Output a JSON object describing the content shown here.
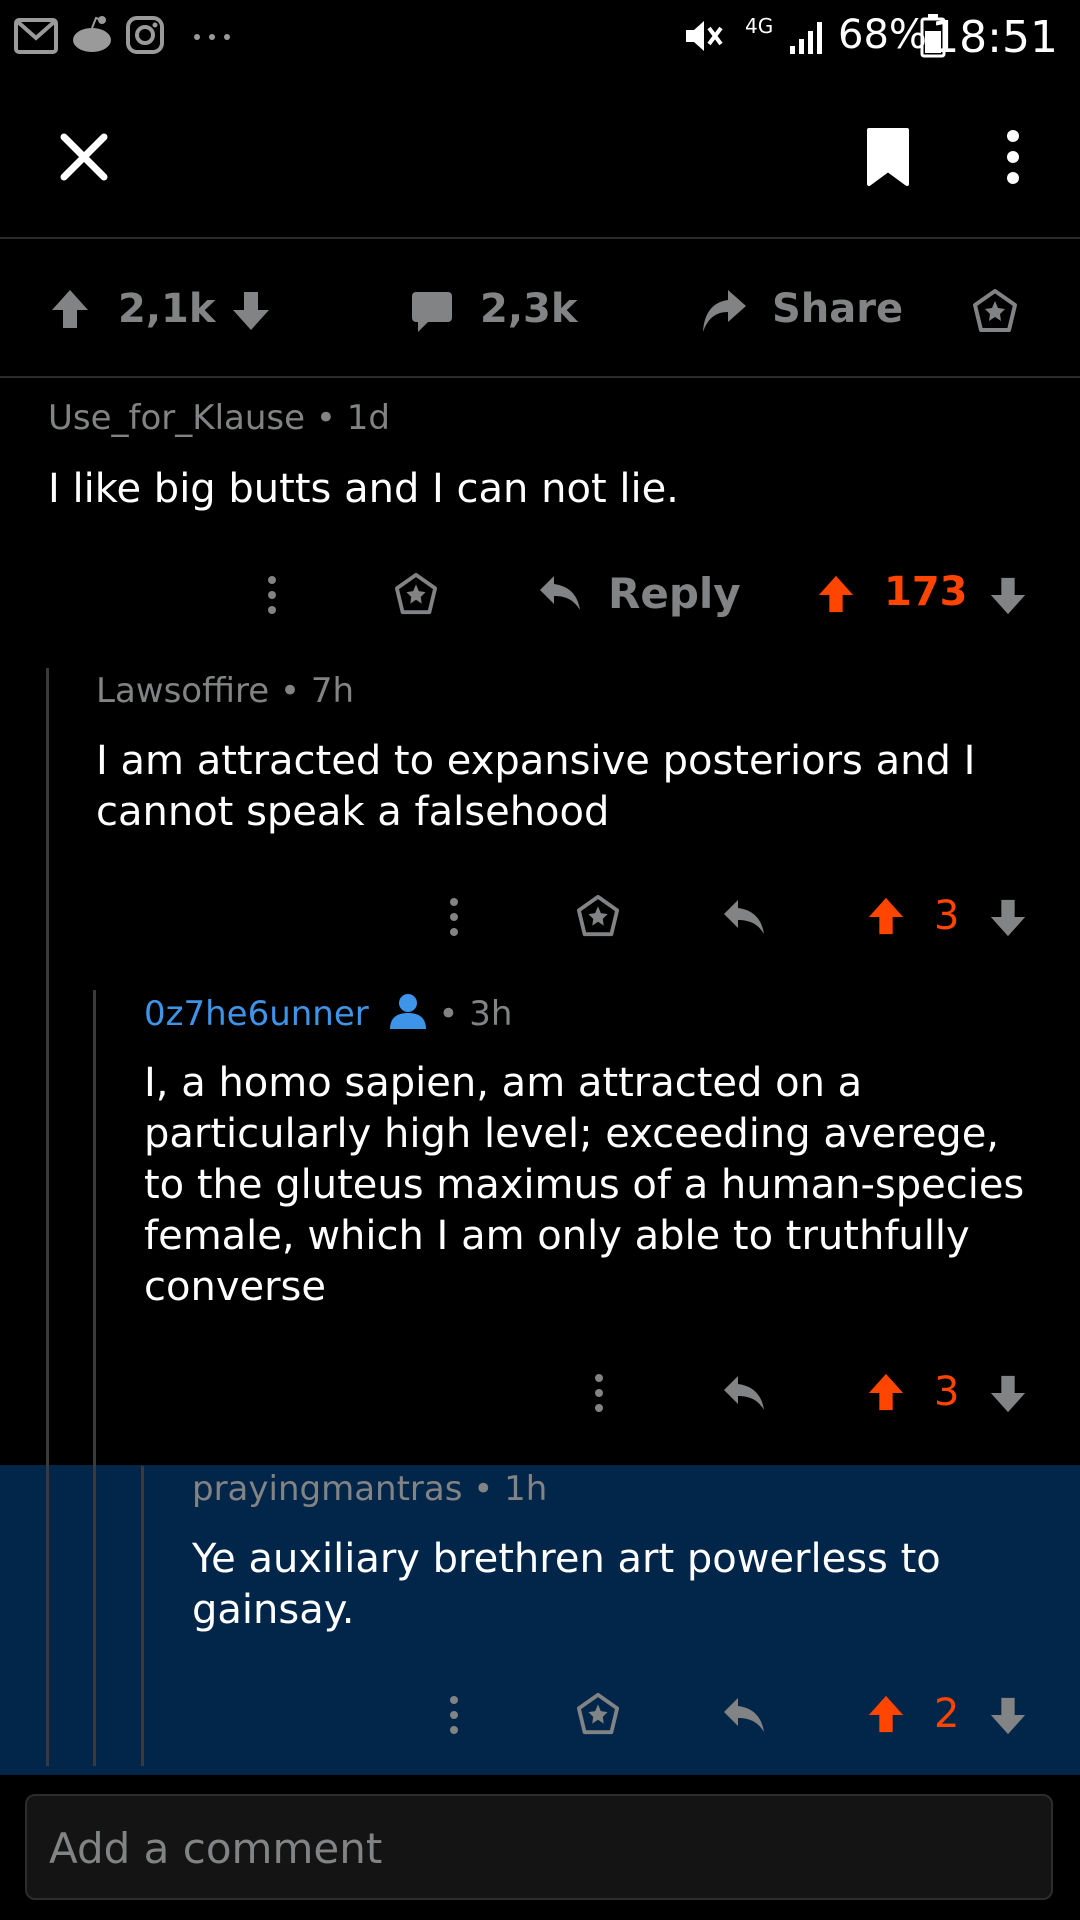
{
  "status_bar": {
    "battery": "68%",
    "time": "18:51",
    "network": "4G",
    "icons": [
      "gmail-icon",
      "reddit-icon",
      "instagram-icon",
      "more-dots-icon",
      "mute-icon",
      "signal-icon",
      "battery-icon"
    ]
  },
  "toolbar": {
    "icons": [
      "close-icon",
      "bookmark-icon",
      "overflow-menu-icon"
    ]
  },
  "post_actions": {
    "upvotes": "2,1k",
    "comments": "2,3k",
    "share_label": "Share"
  },
  "comments": [
    {
      "author": "Use_for_Klause",
      "age": "1d",
      "body": "I like big butts and I can not lie.",
      "reply_label": "Reply",
      "score": "173"
    },
    {
      "author": "Lawsoffire",
      "age": "7h",
      "body": "I am attracted to expansive posteriors and I cannot speak a falsehood",
      "score": "3"
    },
    {
      "author": "0z7he6unner",
      "age": "3h",
      "body": "I, a homo sapien, am attracted on a particularly high level; exceeding averege, to the gluteus maximus of a human-species female, which I am only able to truthfully converse",
      "score": "3"
    },
    {
      "author": "prayingmantras",
      "age": "1h",
      "body": "Ye auxiliary brethren art powerless to gainsay.",
      "score": "2"
    }
  ],
  "compose": {
    "placeholder": "Add a comment"
  },
  "colors": {
    "upvote": "#ff4500",
    "muted": "#818384",
    "highlight": "#022649",
    "op_user": "#3d94e9"
  }
}
